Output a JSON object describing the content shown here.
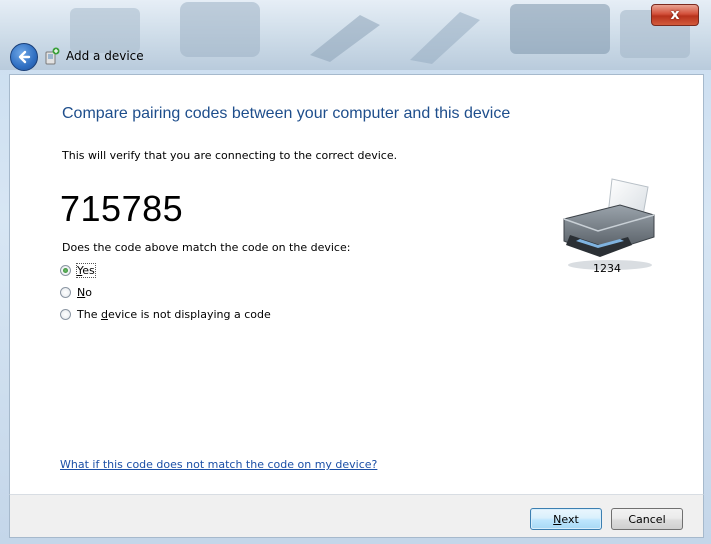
{
  "window": {
    "title": "Add a device",
    "close_glyph": "x"
  },
  "main": {
    "heading": "Compare pairing codes between your computer and this device",
    "subtext": "This will verify that you are connecting to the correct device.",
    "pairing_code": "715785",
    "question": "Does the code above match the code on the device:",
    "options": [
      {
        "prefix": "",
        "accel": "Y",
        "rest": "es",
        "checked": true
      },
      {
        "prefix": "",
        "accel": "N",
        "rest": "o",
        "checked": false
      },
      {
        "prefix": "The ",
        "accel": "d",
        "rest": "evice is not displaying a code",
        "checked": false
      }
    ],
    "device": {
      "name": "1234",
      "icon": "printer-icon"
    },
    "help_link": "What if this code does not match the code on my device?"
  },
  "footer": {
    "next": {
      "accel": "N",
      "rest": "ext"
    },
    "cancel_label": "Cancel"
  },
  "colors": {
    "heading": "#1e4e8c",
    "link": "#1b4fa6",
    "close_button": "#c8472e",
    "back_button": "#2f6fc2"
  }
}
